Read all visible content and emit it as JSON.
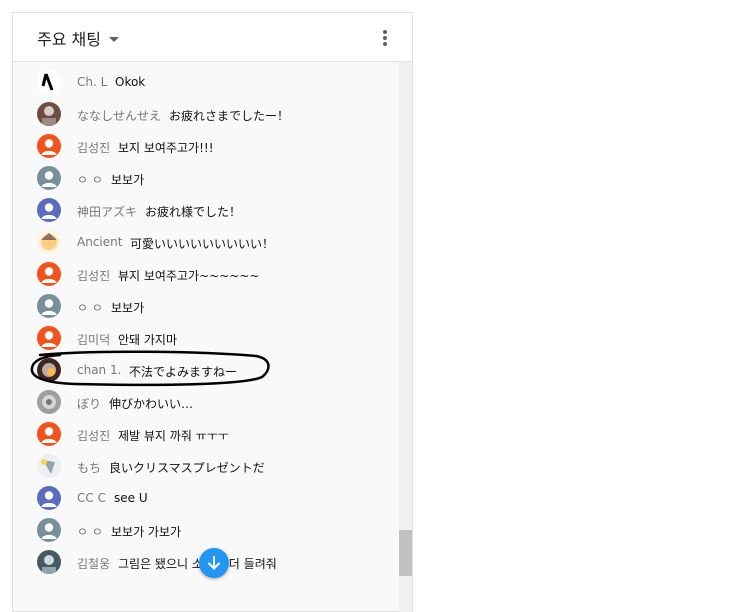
{
  "header": {
    "title": "주요 채팅",
    "dropdown_icon": "chevron-down-icon",
    "menu_icon": "more-vert-icon"
  },
  "colors": {
    "accent": "#2196f3",
    "avatar_orange": "#f4511e",
    "avatar_grey": "#78909c",
    "avatar_indigo": "#5c6bc0"
  },
  "messages": [
    {
      "author": "Ch. L",
      "text": "Okok",
      "avatar": "image"
    },
    {
      "author": "ななしせんせえ",
      "text": "お疲れさまでしたー！",
      "avatar": "image"
    },
    {
      "author": "김성진",
      "text": "보지 보여주고가!!!",
      "avatar": "orange"
    },
    {
      "author": "ㅇ ㅇ",
      "text": "보보가",
      "avatar": "grey"
    },
    {
      "author": "神田アズキ",
      "text": "お疲れ様でした！",
      "avatar": "indigo"
    },
    {
      "author": "Ancient",
      "text": "可愛いいいいいいいいい！",
      "avatar": "image"
    },
    {
      "author": "김성진",
      "text": "뷰지 보여주고가~~~~~~",
      "avatar": "orange"
    },
    {
      "author": "ㅇ ㅇ",
      "text": "보보가",
      "avatar": "grey"
    },
    {
      "author": "김미덕",
      "text": "안돼 가지마",
      "avatar": "orange"
    },
    {
      "author": "chan 1.",
      "text": "不法でよみますねー",
      "avatar": "image"
    },
    {
      "author": "ぼり",
      "text": "伸びかわいい…",
      "avatar": "image"
    },
    {
      "author": "김성진",
      "text": "제발 뷰지 까줘 ㅠㅜㅜ",
      "avatar": "orange"
    },
    {
      "author": "もち",
      "text": "良いクリスマスプレゼントだ",
      "avatar": "image"
    },
    {
      "author": "CC C",
      "text": "see U",
      "avatar": "indigo"
    },
    {
      "author": "ㅇ ㅇ",
      "text": "보보가 가보가",
      "avatar": "grey"
    },
    {
      "author": "김철웅",
      "text": "그림은 됐으니 소리나 더 들려줘",
      "avatar": "image"
    }
  ],
  "scroll_down_icon": "arrow-down-icon"
}
